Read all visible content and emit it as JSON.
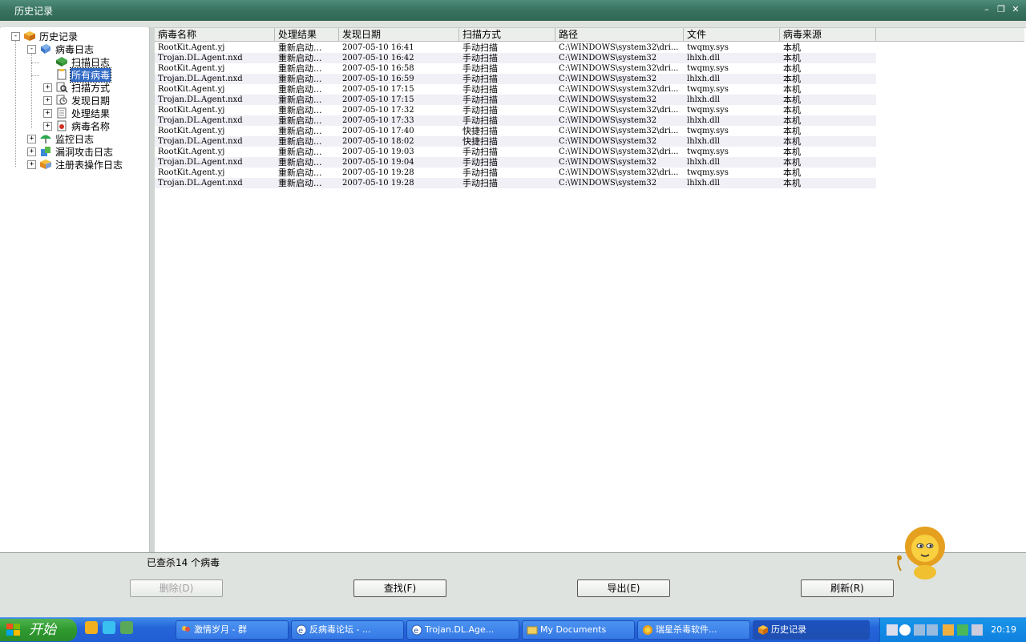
{
  "window": {
    "title": "历史记录"
  },
  "tree": {
    "root": "历史记录",
    "virus_log": "病毒日志",
    "scan_log": "扫描日志",
    "all_viruses": "所有病毒",
    "scan_method": "扫描方式",
    "found_date": "发现日期",
    "result": "处理结果",
    "virus_name": "病毒名称",
    "monitor_log": "监控日志",
    "exploit_log": "漏洞攻击日志",
    "registry_log": "注册表操作日志"
  },
  "table": {
    "columns": [
      "病毒名称",
      "处理结果",
      "发现日期",
      "扫描方式",
      "路径",
      "文件",
      "病毒来源"
    ],
    "rows": [
      [
        "RootKit.Agent.yj",
        "重新启动...",
        "2007-05-10 16:41",
        "手动扫描",
        "C:\\WINDOWS\\system32\\dri...",
        "twqmy.sys",
        "本机"
      ],
      [
        "Trojan.DL.Agent.nxd",
        "重新启动...",
        "2007-05-10 16:42",
        "手动扫描",
        "C:\\WINDOWS\\system32",
        "lhlxh.dll",
        "本机"
      ],
      [
        "RootKit.Agent.yj",
        "重新启动...",
        "2007-05-10 16:58",
        "手动扫描",
        "C:\\WINDOWS\\system32\\dri...",
        "twqmy.sys",
        "本机"
      ],
      [
        "Trojan.DL.Agent.nxd",
        "重新启动...",
        "2007-05-10 16:59",
        "手动扫描",
        "C:\\WINDOWS\\system32",
        "lhlxh.dll",
        "本机"
      ],
      [
        "RootKit.Agent.yj",
        "重新启动...",
        "2007-05-10 17:15",
        "手动扫描",
        "C:\\WINDOWS\\system32\\dri...",
        "twqmy.sys",
        "本机"
      ],
      [
        "Trojan.DL.Agent.nxd",
        "重新启动...",
        "2007-05-10 17:15",
        "手动扫描",
        "C:\\WINDOWS\\system32",
        "lhlxh.dll",
        "本机"
      ],
      [
        "RootKit.Agent.yj",
        "重新启动...",
        "2007-05-10 17:32",
        "手动扫描",
        "C:\\WINDOWS\\system32\\dri...",
        "twqmy.sys",
        "本机"
      ],
      [
        "Trojan.DL.Agent.nxd",
        "重新启动...",
        "2007-05-10 17:33",
        "手动扫描",
        "C:\\WINDOWS\\system32",
        "lhlxh.dll",
        "本机"
      ],
      [
        "RootKit.Agent.yj",
        "重新启动...",
        "2007-05-10 17:40",
        "快捷扫描",
        "C:\\WINDOWS\\system32\\dri...",
        "twqmy.sys",
        "本机"
      ],
      [
        "Trojan.DL.Agent.nxd",
        "重新启动...",
        "2007-05-10 18:02",
        "快捷扫描",
        "C:\\WINDOWS\\system32",
        "lhlxh.dll",
        "本机"
      ],
      [
        "RootKit.Agent.yj",
        "重新启动...",
        "2007-05-10 19:03",
        "手动扫描",
        "C:\\WINDOWS\\system32\\dri...",
        "twqmy.sys",
        "本机"
      ],
      [
        "Trojan.DL.Agent.nxd",
        "重新启动...",
        "2007-05-10 19:04",
        "手动扫描",
        "C:\\WINDOWS\\system32",
        "lhlxh.dll",
        "本机"
      ],
      [
        "RootKit.Agent.yj",
        "重新启动...",
        "2007-05-10 19:28",
        "手动扫描",
        "C:\\WINDOWS\\system32\\dri...",
        "twqmy.sys",
        "本机"
      ],
      [
        "Trojan.DL.Agent.nxd",
        "重新启动...",
        "2007-05-10 19:28",
        "手动扫描",
        "C:\\WINDOWS\\system32",
        "lhlxh.dll",
        "本机"
      ]
    ]
  },
  "status": "已查杀14 个病毒",
  "buttons": {
    "delete": "删除(D)",
    "find": "查找(F)",
    "export": "导出(E)",
    "refresh": "刷新(R)"
  },
  "taskbar": {
    "start": "开始",
    "tasks": [
      "激情岁月 - 群",
      "反病毒论坛 - ...",
      "Trojan.DL.Age...",
      "My Documents",
      "瑞星杀毒软件...",
      "历史记录"
    ],
    "clock": "20:19"
  },
  "colors": {
    "titlebar": "#3a7562",
    "selection": "#316ac5",
    "taskbar": "#2464d9",
    "start_button": "#2e9a2e",
    "alt_row": "#f0f0f6"
  }
}
